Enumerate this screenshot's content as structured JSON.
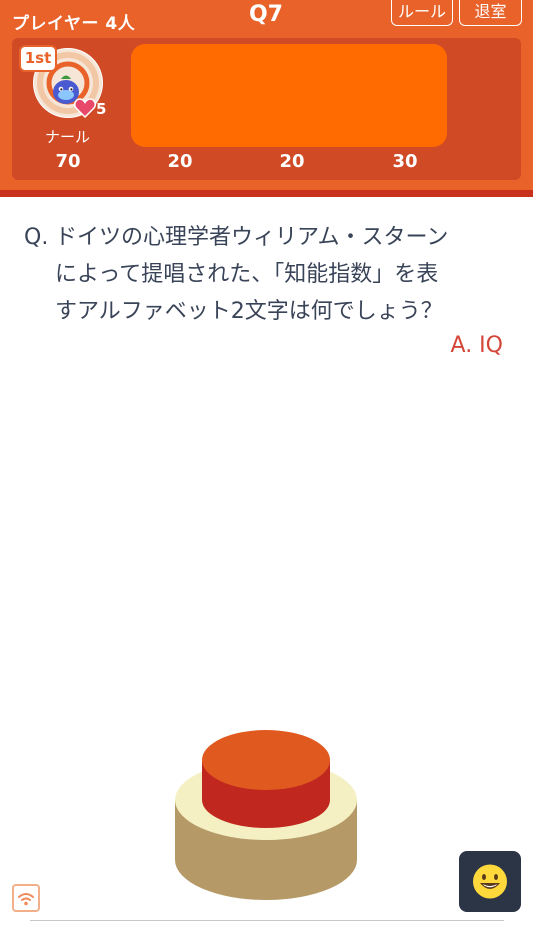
{
  "header": {
    "players_count": "プレイヤー 4人",
    "question_no": "Q7",
    "rule_label": "ルール",
    "exit_label": "退室"
  },
  "player": {
    "rank": "1st",
    "hearts": "5",
    "name": "ナール"
  },
  "scores": [
    "70",
    "20",
    "20",
    "30"
  ],
  "question": {
    "prefix": "Q.",
    "text": "ドイツの心理学者ウィリアム・スターン\nによって提唱された、「知能指数」を表\nすアルファベット2文字は何でしょう？",
    "answer": "A. IQ"
  },
  "icons": {
    "buzzer": "buzzer-button",
    "wifi": "wifi-icon",
    "emoji": "smiley-face-icon",
    "heart": "heart-icon"
  },
  "colors": {
    "header": "#e8622a",
    "panel": "#cf4a25",
    "answer_slot": "#ff6b00",
    "answer_text": "#d4463a",
    "buzzer_top": "#e05a20",
    "buzzer_rim": "#c0281f",
    "buzzer_base_top": "#f5f0c4",
    "buzzer_base_side": "#b59a68"
  }
}
